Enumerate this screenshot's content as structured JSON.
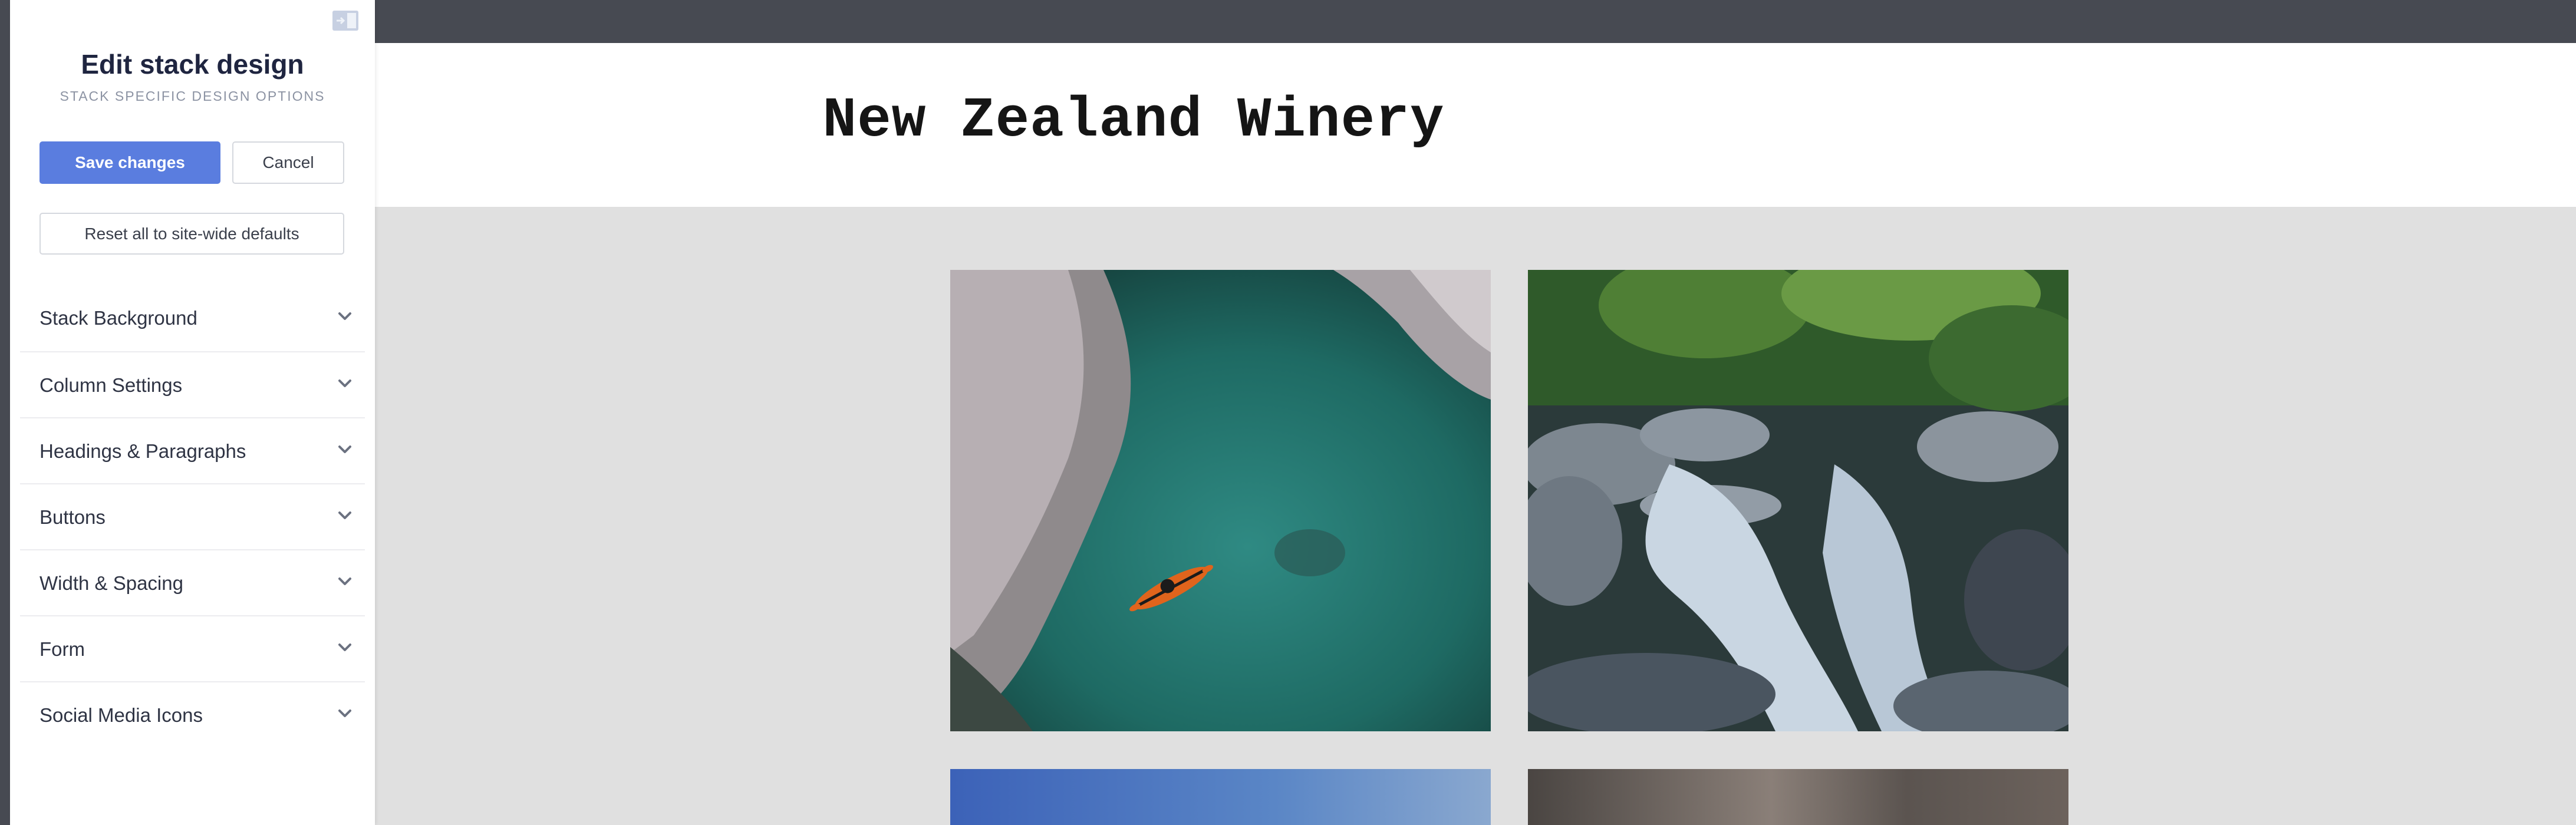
{
  "panel": {
    "title": "Edit stack design",
    "subtitle": "STACK SPECIFIC DESIGN OPTIONS",
    "save_label": "Save changes",
    "cancel_label": "Cancel",
    "reset_label": "Reset all to site-wide defaults",
    "sections": [
      {
        "label": "Stack Background"
      },
      {
        "label": "Column Settings"
      },
      {
        "label": "Headings & Paragraphs"
      },
      {
        "label": "Buttons"
      },
      {
        "label": "Width & Spacing"
      },
      {
        "label": "Form"
      },
      {
        "label": "Social Media Icons"
      }
    ],
    "icons": {
      "collapse": "sidebar-collapse-icon",
      "chevron": "chevron-down-icon"
    }
  },
  "site": {
    "title": "New Zealand Winery",
    "images": [
      {
        "name": "kayak-river-photo"
      },
      {
        "name": "forest-stream-photo"
      },
      {
        "name": "sky-photo"
      },
      {
        "name": "blurred-rock-photo"
      }
    ]
  },
  "colors": {
    "topbar": "#474a52",
    "accent": "#5a7ddf",
    "background": "#e0e0e0",
    "panel": "#ffffff"
  }
}
